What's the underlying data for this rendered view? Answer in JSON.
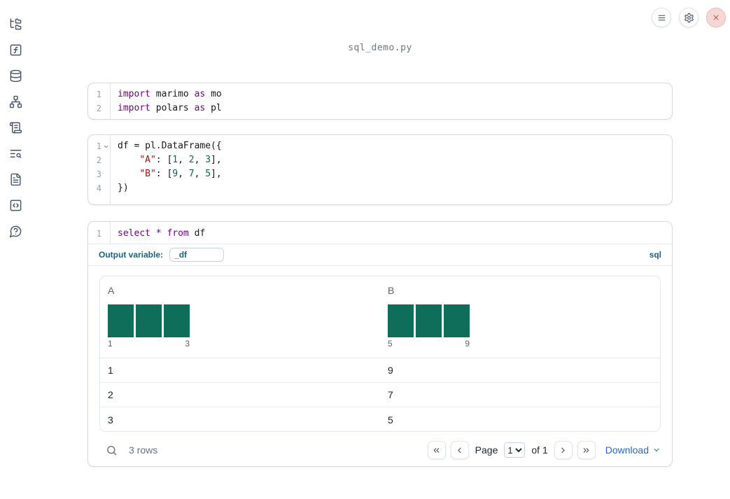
{
  "window": {
    "title": "sql_demo.py"
  },
  "topbar": {
    "buttons": [
      "menu",
      "settings",
      "close"
    ]
  },
  "sidebar": {
    "icons": [
      "file-explorer",
      "variables",
      "datasources",
      "dependency-graph",
      "logs",
      "outline-search",
      "documentation",
      "snippets",
      "help"
    ]
  },
  "cells": [
    {
      "name": "imports-cell",
      "lines": [
        {
          "num": "1",
          "tokens": [
            [
              "kw",
              "import"
            ],
            [
              "pl",
              " marimo "
            ],
            [
              "kw",
              "as"
            ],
            [
              "pl",
              " mo"
            ]
          ]
        },
        {
          "num": "2",
          "tokens": [
            [
              "kw",
              "import"
            ],
            [
              "pl",
              " polars "
            ],
            [
              "kw",
              "as"
            ],
            [
              "pl",
              " pl"
            ]
          ]
        }
      ]
    },
    {
      "name": "dataframe-cell",
      "lines": [
        {
          "num": "1",
          "fold": true,
          "tokens": [
            [
              "pl",
              "df = pl.DataFrame({"
            ]
          ]
        },
        {
          "num": "2",
          "tokens": [
            [
              "pl",
              "    "
            ],
            [
              "str",
              "\"A\""
            ],
            [
              "pl",
              ": ["
            ],
            [
              "num",
              "1"
            ],
            [
              "pl",
              ", "
            ],
            [
              "num",
              "2"
            ],
            [
              "pl",
              ", "
            ],
            [
              "num",
              "3"
            ],
            [
              "pl",
              "],"
            ]
          ]
        },
        {
          "num": "3",
          "tokens": [
            [
              "pl",
              "    "
            ],
            [
              "str",
              "\"B\""
            ],
            [
              "pl",
              ": ["
            ],
            [
              "num",
              "9"
            ],
            [
              "pl",
              ", "
            ],
            [
              "num",
              "7"
            ],
            [
              "pl",
              ", "
            ],
            [
              "num",
              "5"
            ],
            [
              "pl",
              "],"
            ]
          ]
        },
        {
          "num": "4",
          "tokens": [
            [
              "pl",
              "})"
            ]
          ]
        }
      ]
    }
  ],
  "sql_cell": {
    "lines": [
      {
        "num": "1",
        "tokens": [
          [
            "kw",
            "select"
          ],
          [
            "pl",
            " "
          ],
          [
            "kw",
            "*"
          ],
          [
            "pl",
            " "
          ],
          [
            "kw",
            "from"
          ],
          [
            "pl",
            " df"
          ]
        ]
      }
    ],
    "output_variable_label": "Output variable:",
    "output_variable_value": "_df",
    "language_badge": "sql"
  },
  "table": {
    "columns": [
      {
        "name": "A",
        "histogram": {
          "type": "bar",
          "bar_heights": [
            1,
            1,
            1
          ],
          "values": [
            1,
            2,
            3
          ],
          "min_label": "1",
          "max_label": "3"
        }
      },
      {
        "name": "B",
        "histogram": {
          "type": "bar",
          "bar_heights": [
            1,
            1,
            1
          ],
          "values": [
            9,
            7,
            5
          ],
          "min_label": "5",
          "max_label": "9"
        }
      }
    ],
    "rows": [
      [
        "1",
        "9"
      ],
      [
        "2",
        "7"
      ],
      [
        "3",
        "5"
      ]
    ],
    "footer": {
      "row_count": "3 rows",
      "page_label": "Page",
      "page_value": "1",
      "of_label": "of 1",
      "download_label": "Download"
    }
  },
  "colors": {
    "accent_teal_blue": "#19647e",
    "download_link_blue": "#2468d4",
    "histogram_bar": "#0e6e5a",
    "code_keyword": "#770088",
    "code_string": "#a11111",
    "code_number": "#106444",
    "close_button_bg": "#f7d6d6",
    "close_button_icon": "#c25757",
    "sidebar_icon": "#44546e"
  }
}
